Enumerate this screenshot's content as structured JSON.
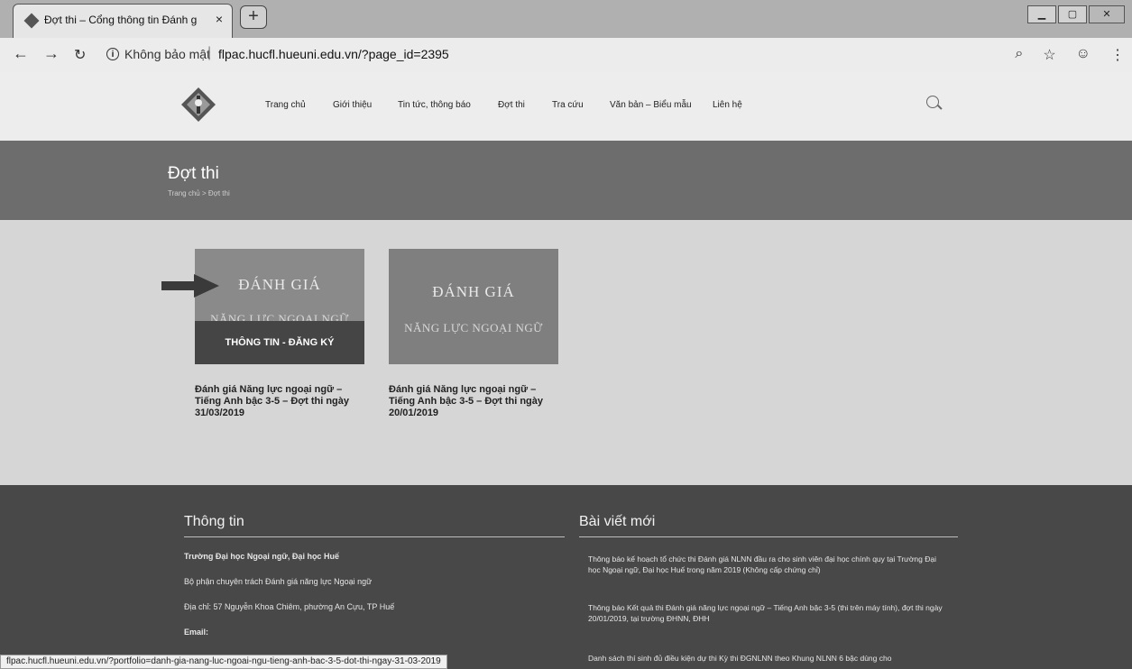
{
  "browser": {
    "tab_title": "Đợt thi – Cổng thông tin Đánh g",
    "tab_close": "×",
    "new_tab": "+",
    "security_label": "Không bảo mật",
    "url": "flpac.hucfl.hueuni.edu.vn/?page_id=2395",
    "status_url": "flpac.hucfl.hueuni.edu.vn/?portfolio=danh-gia-nang-luc-ngoai-ngu-tieng-anh-bac-3-5-dot-thi-ngay-31-03-2019"
  },
  "nav": {
    "items": [
      "Trang chủ",
      "Giới thiệu",
      "Tin tức, thông báo",
      "Đợt thi",
      "Tra cứu",
      "Văn bản – Biểu mẫu",
      "Liên hệ"
    ]
  },
  "page": {
    "title": "Đợt thi",
    "breadcrumb": "Trang chủ  >  Đợt thi"
  },
  "cards": [
    {
      "img_line1": "ĐÁNH GIÁ",
      "img_line2": "NĂNG LỰC NGOẠI NGỮ",
      "overlay": "THÔNG TIN - ĐĂNG KÝ",
      "caption": "Đánh giá Năng lực ngoại ngữ – Tiếng Anh bậc 3-5 – Đợt thi ngày 31/03/2019"
    },
    {
      "img_line1": "ĐÁNH GIÁ",
      "img_line2": "NĂNG LỰC NGOẠI NGỮ",
      "caption": "Đánh giá Năng lực ngoại ngữ – Tiếng Anh bậc 3-5 – Đợt thi ngày 20/01/2019"
    }
  ],
  "footer": {
    "info_heading": "Thông tin",
    "info_lines": [
      "Trường Đại học Ngoại ngữ, Đại học Huế",
      "Bộ phận chuyên trách Đánh giá năng lực Ngoại ngữ",
      "Địa chỉ: 57 Nguyễn Khoa Chiêm, phường An Cựu, TP Huế",
      "Email:"
    ],
    "posts_heading": "Bài viết mới",
    "posts": [
      "Thông báo kế hoạch tổ chức thi Đánh giá NLNN đầu ra cho sinh viên đại học chính quy tại Trường Đại học Ngoại ngữ, Đại học Huế trong năm 2019 (Không cấp chứng chỉ)",
      "Thông báo Kết quả thi Đánh giá năng lực ngoại ngữ – Tiếng Anh bậc 3-5 (thi trên máy tính), đợt thi ngày 20/01/2019, tại trường ĐHNN, ĐHH",
      "Danh sách thí sinh đủ điều kiện dự thi Kỳ thi ĐGNLNN theo Khung NLNN 6 bậc dùng cho"
    ]
  }
}
